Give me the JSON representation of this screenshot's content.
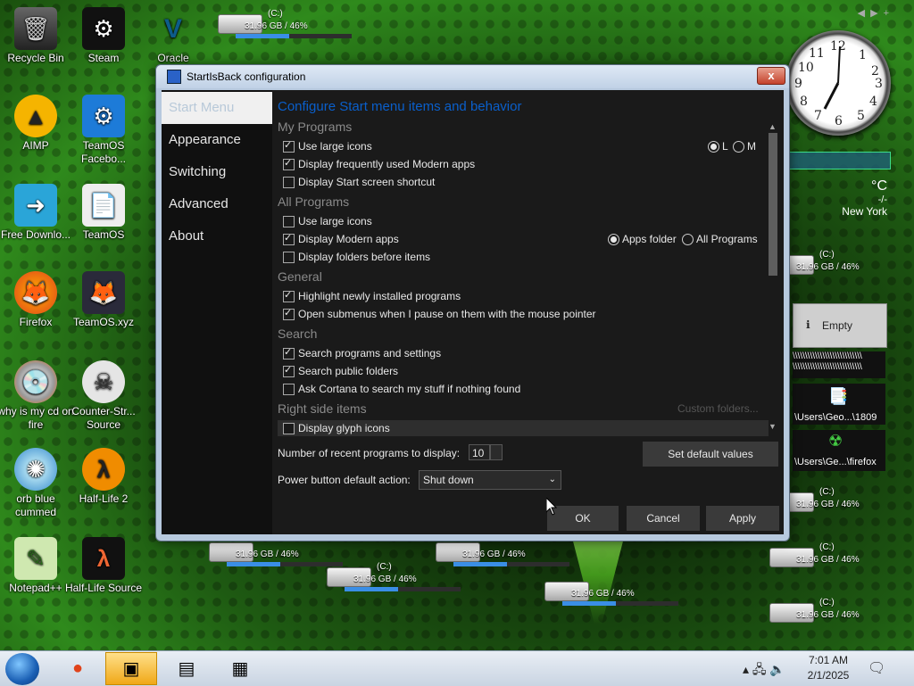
{
  "desktop": {
    "icons": [
      {
        "label": "Recycle Bin",
        "glyph": "🗑"
      },
      {
        "label": "Steam",
        "glyph": "⚙"
      },
      {
        "label": "Oracle",
        "glyph": "V"
      },
      {
        "label": "AIMP",
        "glyph": "▲"
      },
      {
        "label": "TeamOS Facebo...",
        "glyph": "⚙"
      },
      {
        "label": "Free Downlo...",
        "glyph": "➜"
      },
      {
        "label": "TeamOS",
        "glyph": "📄"
      },
      {
        "label": "Firefox",
        "glyph": "🦊"
      },
      {
        "label": "TeamOS.xyz",
        "glyph": "🦊"
      },
      {
        "label": "why is my cd on fire",
        "glyph": "💿"
      },
      {
        "label": "Counter-Str... Source",
        "glyph": "☠"
      },
      {
        "label": "orb blue cummed",
        "glyph": "✺"
      },
      {
        "label": "Half-Life 2",
        "glyph": "λ"
      },
      {
        "label": "Notepad++",
        "glyph": "✎"
      },
      {
        "label": "Half-Life Source",
        "glyph": "λ"
      }
    ],
    "drive_name": "(C:)",
    "drive_usage": "31.96 GB / 46%",
    "drive_percent": 46
  },
  "dialog": {
    "title": "StartIsBack configuration",
    "close": "x",
    "nav": [
      "Start Menu",
      "Appearance",
      "Switching",
      "Advanced",
      "About"
    ],
    "heading": "Configure Start menu items and behavior",
    "sections": {
      "my_programs": "My Programs",
      "all_programs": "All Programs",
      "general": "General",
      "search": "Search",
      "right_side": "Right side items"
    },
    "options": {
      "use_large_icons_1": "Use large icons",
      "display_modern_apps_freq": "Display frequently used Modern apps",
      "display_start_shortcut": "Display Start screen shortcut",
      "use_large_icons_2": "Use large icons",
      "display_modern_apps": "Display Modern apps",
      "display_folders_before": "Display folders before items",
      "highlight_new": "Highlight newly installed programs",
      "open_submenus": "Open submenus when I pause on them with the mouse pointer",
      "search_programs": "Search programs and settings",
      "search_public": "Search public folders",
      "ask_cortana": "Ask Cortana to search my stuff if nothing found",
      "display_glyph": "Display glyph icons"
    },
    "radios": {
      "size_l": "L",
      "size_m": "M",
      "apps_folder": "Apps folder",
      "all_programs": "All Programs"
    },
    "custom_folders": "Custom folders...",
    "recent_label": "Number of recent programs to display:",
    "recent_value": "10",
    "set_default": "Set default values",
    "power_label": "Power button default action:",
    "power_value": "Shut down",
    "ok": "OK",
    "cancel": "Cancel",
    "apply": "Apply"
  },
  "gadgets": {
    "clock_numbers": [
      "12",
      "1",
      "2",
      "3",
      "4",
      "5",
      "6",
      "7",
      "8",
      "9",
      "10",
      "11"
    ],
    "weather_unit": "°C",
    "weather_dash": "-/-",
    "weather_city": "New York",
    "empty_label": "Empty",
    "slashes": "\\\\\\\\\\\\\\\\\\\\\\\\\\\\\\\\\\\\\\\\\\\\\\\\\\\\\\\\",
    "shortcut1": "\\Users\\Geo...\\1809",
    "shortcut2": "\\Users\\Ge...\\firefox"
  },
  "taskbar": {
    "time": "7:01 AM",
    "date": "2/1/2025"
  },
  "colors": {
    "accent": "#0a5fcb",
    "dialog_bg": "#1a1a1a",
    "drive_bar": "#3a8ee6"
  }
}
